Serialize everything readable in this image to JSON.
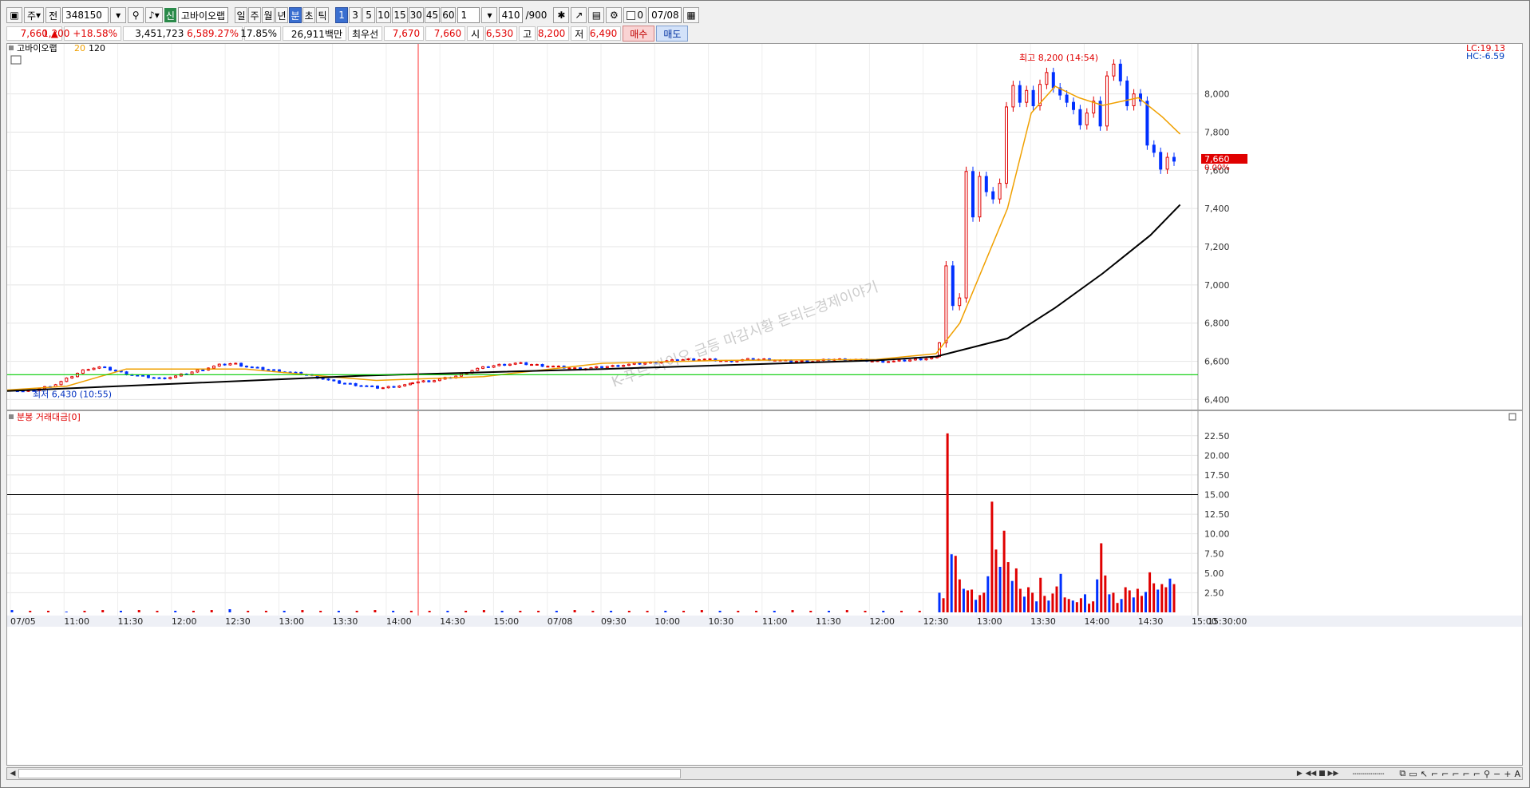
{
  "toolbar": {
    "mode_label": "주",
    "type_label": "전",
    "code_value": "348150",
    "badge_label": "신",
    "stock_name": "고바이오랩",
    "period_buttons": [
      "일",
      "주",
      "월",
      "년",
      "분",
      "초",
      "틱"
    ],
    "active_period": "분",
    "interval_buttons": [
      "1",
      "3",
      "5",
      "10",
      "15",
      "30",
      "45",
      "60"
    ],
    "active_interval": "1",
    "interval_select": "1",
    "count_value": "410",
    "count_total": "/900",
    "date_value": "07/08",
    "checkbox_label": "0"
  },
  "info": {
    "price": "7,660",
    "arrow": "▲",
    "change": "1,200",
    "change_pct": "+18.58%",
    "volume": "3,451,723",
    "volume_pct": "6,589.27%",
    "turnover_pct": "17.85%",
    "amount": "26,911백만",
    "best_label": "최우선",
    "best_ask": "7,670",
    "best_bid": "7,660",
    "open_label": "시",
    "open_value": "6,530",
    "high_label": "고",
    "high_value": "8,200",
    "low_label": "저",
    "low_value": "6,490",
    "buy_label": "매수",
    "sell_label": "매도"
  },
  "price_panel": {
    "legend_name": "고바이오랩",
    "legend_ma1": "20",
    "legend_ma2": "120",
    "lc_label": "LC:19.13",
    "hc_label": "HC:-6.59",
    "high_annotation": "최고 8,200 (14:54)",
    "low_annotation": "최저 6,430 (10:55)",
    "current_price_tag": "7,660",
    "current_pct_tag": "0.00%",
    "watermark": "K-푸드 바이오 급등 마감시황 돈되는경제이야기",
    "y_ticks": [
      "8,000",
      "7,800",
      "7,600",
      "7,400",
      "7,200",
      "7,000",
      "6,800",
      "6,600",
      "6,400"
    ],
    "colors": {
      "up": "#e00000",
      "down": "#0030ff",
      "ma20": "#f0a000",
      "ma120": "#000000",
      "support": "#00cc00",
      "divider": "#ff3030"
    }
  },
  "volume_panel": {
    "legend": "분봉 거래대금[0]",
    "y_ticks": [
      "22.50",
      "20.00",
      "17.50",
      "15.00",
      "12.50",
      "10.00",
      "7.50",
      "5.00",
      "2.50"
    ]
  },
  "x_axis": {
    "labels": [
      "07/05",
      "11:00",
      "11:30",
      "12:00",
      "12:30",
      "13:00",
      "13:30",
      "14:00",
      "14:30",
      "15:00",
      "07/08",
      "09:30",
      "10:00",
      "10:30",
      "11:00",
      "11:30",
      "12:00",
      "12:30",
      "13:00",
      "13:30",
      "14:00",
      "14:30",
      "15:00",
      "15:30:00"
    ]
  },
  "chart_data": {
    "type": "candlestick",
    "ylim": [
      6360,
      8220
    ],
    "reference_line": 6530,
    "high": {
      "value": 8200,
      "time": "14:54"
    },
    "low": {
      "value": 6430,
      "time": "10:55"
    },
    "closes_phase1": [
      6450,
      6440,
      6460,
      6480,
      6520,
      6560,
      6570,
      6550,
      6530,
      6520,
      6510,
      6520,
      6540,
      6560,
      6580,
      6590,
      6570,
      6560,
      6550,
      6540,
      6530,
      6510,
      6490,
      6480,
      6470,
      6460,
      6470,
      6480
    ],
    "closes_phase2": [
      6490,
      6500,
      6520,
      6560,
      6580,
      6590,
      6580,
      6570,
      6560,
      6570,
      6580,
      6590,
      6600,
      6610,
      6610,
      6600,
      6610,
      6610,
      6600,
      6600,
      6610,
      6610,
      6600,
      6600,
      6610,
      6620
    ],
    "closes_phase3": [
      6700,
      7100,
      6880,
      6950,
      7600,
      7350,
      7550,
      7500,
      7450,
      7520,
      7950,
      8050,
      7950,
      8000,
      7950,
      8050,
      8100,
      8050,
      8000,
      7950,
      7900,
      7850,
      7900,
      7950,
      7850,
      8100,
      8150,
      8050,
      7950,
      8000,
      7950,
      7750,
      7700,
      7600,
      7650,
      7660
    ],
    "ma20_points": [
      [
        0,
        6450
      ],
      [
        0.05,
        6470
      ],
      [
        0.1,
        6560
      ],
      [
        0.2,
        6560
      ],
      [
        0.27,
        6520
      ],
      [
        0.31,
        6500
      ],
      [
        0.4,
        6520
      ],
      [
        0.5,
        6590
      ],
      [
        0.6,
        6605
      ],
      [
        0.73,
        6610
      ],
      [
        0.78,
        6640
      ],
      [
        0.8,
        6800
      ],
      [
        0.84,
        7400
      ],
      [
        0.86,
        7900
      ],
      [
        0.88,
        8040
      ],
      [
        0.9,
        7980
      ],
      [
        0.92,
        7940
      ],
      [
        0.95,
        7980
      ],
      [
        0.97,
        7880
      ],
      [
        0.985,
        7790
      ]
    ],
    "ma120_points": [
      [
        0,
        6445
      ],
      [
        0.3,
        6525
      ],
      [
        0.5,
        6560
      ],
      [
        0.73,
        6605
      ],
      [
        0.78,
        6625
      ],
      [
        0.84,
        6720
      ],
      [
        0.88,
        6880
      ],
      [
        0.92,
        7060
      ],
      [
        0.96,
        7260
      ],
      [
        0.985,
        7420
      ]
    ],
    "volume_bars": [
      0.3,
      0.2,
      0.2,
      0.1,
      0.2,
      0.3,
      0.2,
      0.3,
      0.2,
      0.2,
      0.2,
      0.3,
      0.4,
      0.2,
      0.2,
      0.2,
      0.3,
      0.2,
      0.2,
      0.2,
      0.3,
      0.2,
      0.2,
      0.2,
      0.2,
      0.2,
      0.3,
      0.2,
      0.2,
      0.2,
      0.2,
      0.3,
      0.2,
      0.2,
      0.2,
      0.2,
      0.2,
      0.2,
      0.3,
      0.2,
      0.2,
      0.2,
      0.2,
      0.3,
      0.2,
      0.2,
      0.3,
      0.2,
      0.2,
      0.2,
      0.2,
      2.5,
      1.8,
      22.8,
      7.4,
      7.2,
      4.2,
      3.0,
      2.8,
      2.9,
      1.6,
      2.2,
      2.5,
      4.6,
      14.1,
      8.0,
      5.8,
      10.4,
      6.4,
      4.0,
      5.6,
      3.0,
      2.0,
      3.2,
      2.5,
      1.4,
      4.4,
      2.1,
      1.5,
      2.4,
      3.3,
      4.9,
      1.9,
      1.7,
      1.5,
      1.3,
      1.8,
      2.3,
      1.1,
      1.4,
      4.2,
      8.8,
      4.7,
      2.3,
      2.5,
      1.2,
      1.7,
      3.2,
      2.8,
      1.9,
      3.0,
      2.1,
      2.6,
      5.1,
      3.7,
      2.9,
      3.6,
      3.2,
      4.3,
      3.6
    ]
  }
}
